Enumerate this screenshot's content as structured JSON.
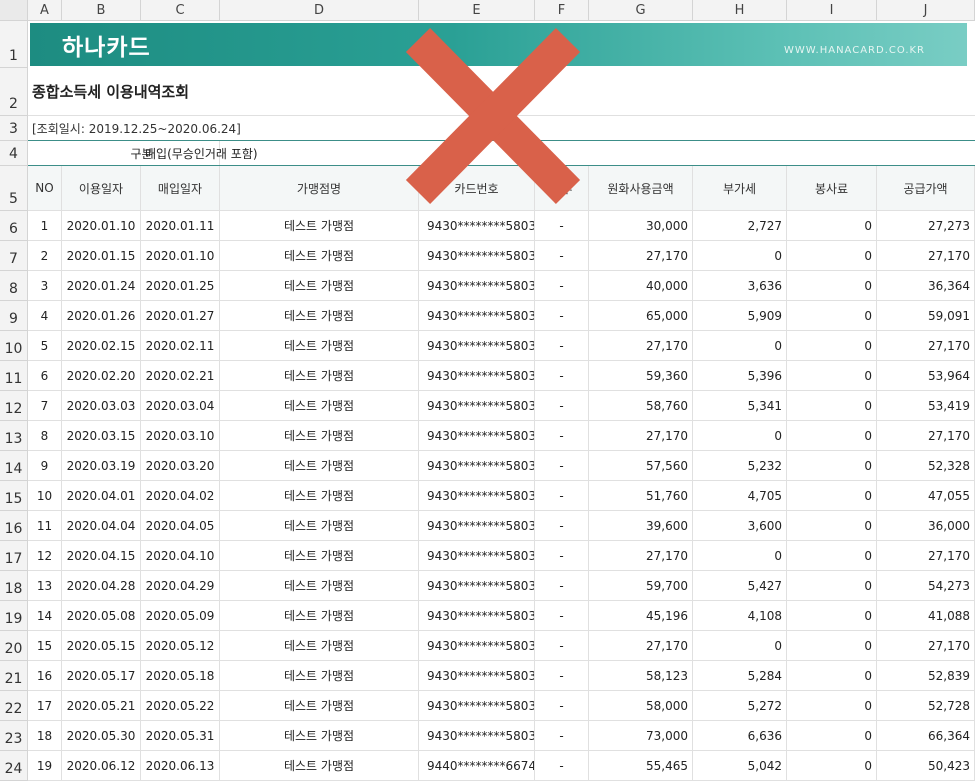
{
  "columns": [
    "A",
    "B",
    "C",
    "D",
    "E",
    "F",
    "G",
    "H",
    "I",
    "J"
  ],
  "row_numbers": [
    "1",
    "2",
    "3",
    "4",
    "5",
    "6",
    "7",
    "8",
    "9",
    "10",
    "11",
    "12",
    "13",
    "14",
    "15",
    "16",
    "17",
    "18",
    "19",
    "20",
    "21",
    "22",
    "23",
    "24"
  ],
  "banner": {
    "logo": "하나카드",
    "url": "WWW.HANACARD.CO.KR",
    "color": "#2aa095"
  },
  "title": "종합소득세 이용내역조회",
  "period": "[조회일시: 2019.12.25~2020.06.24]",
  "filter": {
    "label": "구분",
    "value": "매입(무승인거래 포함)"
  },
  "headers": [
    "NO",
    "이용일자",
    "매입일자",
    "가맹점명",
    "카드번호",
    "할부",
    "원화사용금액",
    "부가세",
    "봉사료",
    "공급가액"
  ],
  "overlay": {
    "icon": "x-mark-icon",
    "color": "#d9614a"
  },
  "rows": [
    [
      "1",
      "2020.01.10",
      "2020.01.11",
      "테스트 가맹점",
      "9430********5803",
      "-",
      "30,000",
      "2,727",
      "0",
      "27,273"
    ],
    [
      "2",
      "2020.01.15",
      "2020.01.10",
      "테스트 가맹점",
      "9430********5803",
      "-",
      "27,170",
      "0",
      "0",
      "27,170"
    ],
    [
      "3",
      "2020.01.24",
      "2020.01.25",
      "테스트 가맹점",
      "9430********5803",
      "-",
      "40,000",
      "3,636",
      "0",
      "36,364"
    ],
    [
      "4",
      "2020.01.26",
      "2020.01.27",
      "테스트 가맹점",
      "9430********5803",
      "-",
      "65,000",
      "5,909",
      "0",
      "59,091"
    ],
    [
      "5",
      "2020.02.15",
      "2020.02.11",
      "테스트 가맹점",
      "9430********5803",
      "-",
      "27,170",
      "0",
      "0",
      "27,170"
    ],
    [
      "6",
      "2020.02.20",
      "2020.02.21",
      "테스트 가맹점",
      "9430********5803",
      "-",
      "59,360",
      "5,396",
      "0",
      "53,964"
    ],
    [
      "7",
      "2020.03.03",
      "2020.03.04",
      "테스트 가맹점",
      "9430********5803",
      "-",
      "58,760",
      "5,341",
      "0",
      "53,419"
    ],
    [
      "8",
      "2020.03.15",
      "2020.03.10",
      "테스트 가맹점",
      "9430********5803",
      "-",
      "27,170",
      "0",
      "0",
      "27,170"
    ],
    [
      "9",
      "2020.03.19",
      "2020.03.20",
      "테스트 가맹점",
      "9430********5803",
      "-",
      "57,560",
      "5,232",
      "0",
      "52,328"
    ],
    [
      "10",
      "2020.04.01",
      "2020.04.02",
      "테스트 가맹점",
      "9430********5803",
      "-",
      "51,760",
      "4,705",
      "0",
      "47,055"
    ],
    [
      "11",
      "2020.04.04",
      "2020.04.05",
      "테스트 가맹점",
      "9430********5803",
      "-",
      "39,600",
      "3,600",
      "0",
      "36,000"
    ],
    [
      "12",
      "2020.04.15",
      "2020.04.10",
      "테스트 가맹점",
      "9430********5803",
      "-",
      "27,170",
      "0",
      "0",
      "27,170"
    ],
    [
      "13",
      "2020.04.28",
      "2020.04.29",
      "테스트 가맹점",
      "9430********5803",
      "-",
      "59,700",
      "5,427",
      "0",
      "54,273"
    ],
    [
      "14",
      "2020.05.08",
      "2020.05.09",
      "테스트 가맹점",
      "9430********5803",
      "-",
      "45,196",
      "4,108",
      "0",
      "41,088"
    ],
    [
      "15",
      "2020.05.15",
      "2020.05.12",
      "테스트 가맹점",
      "9430********5803",
      "-",
      "27,170",
      "0",
      "0",
      "27,170"
    ],
    [
      "16",
      "2020.05.17",
      "2020.05.18",
      "테스트 가맹점",
      "9430********5803",
      "-",
      "58,123",
      "5,284",
      "0",
      "52,839"
    ],
    [
      "17",
      "2020.05.21",
      "2020.05.22",
      "테스트 가맹점",
      "9430********5803",
      "-",
      "58,000",
      "5,272",
      "0",
      "52,728"
    ],
    [
      "18",
      "2020.05.30",
      "2020.05.31",
      "테스트 가맹점",
      "9430********5803",
      "-",
      "73,000",
      "6,636",
      "0",
      "66,364"
    ],
    [
      "19",
      "2020.06.12",
      "2020.06.13",
      "테스트 가맹점",
      "9440********6674",
      "-",
      "55,465",
      "5,042",
      "0",
      "50,423"
    ]
  ]
}
